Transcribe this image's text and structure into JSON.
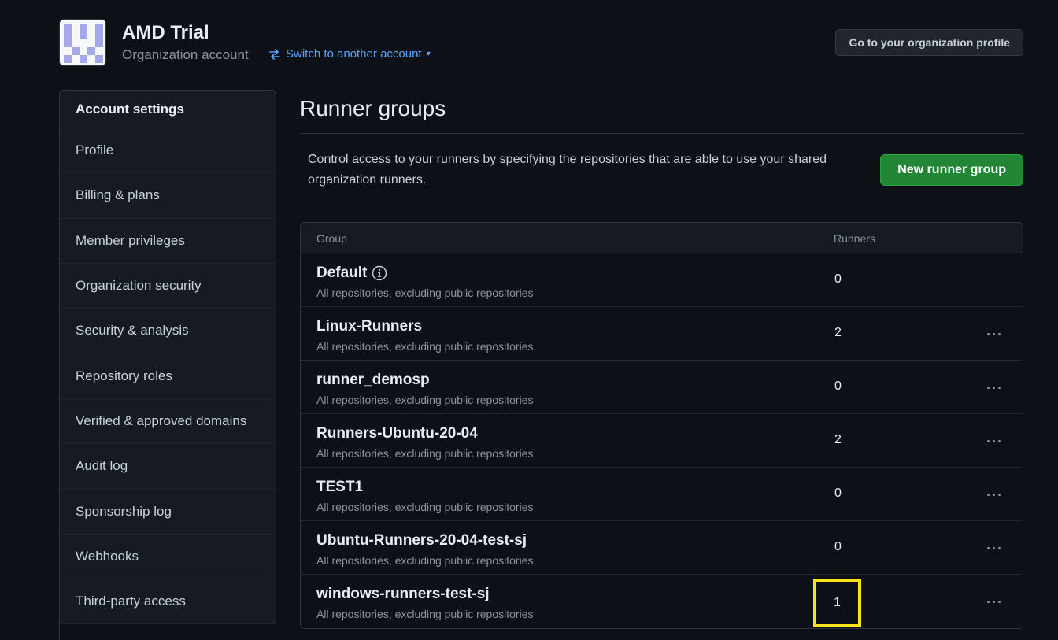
{
  "header": {
    "org_name": "AMD Trial",
    "org_type": "Organization account",
    "switch_label": "Switch to another account",
    "profile_button": "Go to your organization profile"
  },
  "sidebar": {
    "heading": "Account settings",
    "items": [
      {
        "label": "Profile"
      },
      {
        "label": "Billing & plans"
      },
      {
        "label": "Member privileges"
      },
      {
        "label": "Organization security"
      },
      {
        "label": "Security & analysis"
      },
      {
        "label": "Repository roles"
      },
      {
        "label": "Verified & approved domains"
      },
      {
        "label": "Audit log"
      },
      {
        "label": "Sponsorship log"
      },
      {
        "label": "Webhooks"
      },
      {
        "label": "Third-party access"
      }
    ]
  },
  "main": {
    "title": "Runner groups",
    "description": "Control access to your runners by specifying the repositories that are able to use your shared organization runners.",
    "new_button": "New runner group",
    "table": {
      "col_group": "Group",
      "col_runners": "Runners",
      "rows": [
        {
          "name": "Default",
          "access": "All repositories, excluding public repositories",
          "runners": "0"
        },
        {
          "name": "Linux-Runners",
          "access": "All repositories, excluding public repositories",
          "runners": "2"
        },
        {
          "name": "runner_demosp",
          "access": "All repositories, excluding public repositories",
          "runners": "0"
        },
        {
          "name": "Runners-Ubuntu-20-04",
          "access": "All repositories, excluding public repositories",
          "runners": "2"
        },
        {
          "name": "TEST1",
          "access": "All repositories, excluding public repositories",
          "runners": "0"
        },
        {
          "name": "Ubuntu-Runners-20-04-test-sj",
          "access": "All repositories, excluding public repositories",
          "runners": "0"
        },
        {
          "name": "windows-runners-test-sj",
          "access": "All repositories, excluding public repositories",
          "runners": "1"
        }
      ]
    }
  },
  "colors": {
    "background": "#0d1117",
    "accent_link": "#58a6ff",
    "primary_button": "#238636",
    "highlight_box": "#f5e61a"
  }
}
